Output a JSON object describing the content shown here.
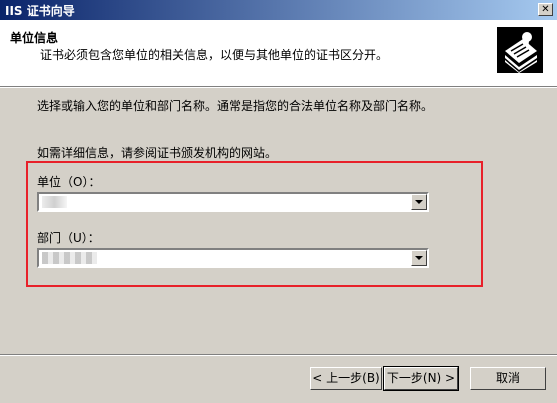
{
  "window": {
    "title": "IIS 证书向导",
    "close_symbol": "✕"
  },
  "header": {
    "title": "单位信息",
    "subtitle": "证书必须包含您单位的相关信息，以便与其他单位的证书区分开。",
    "icon": "certificate-wizard-icon"
  },
  "body": {
    "instruction": "选择或输入您的单位和部门名称。通常是指您的合法单位名称及部门名称。",
    "more_info": "如需详细信息，请参阅证书颁发机构的网站。"
  },
  "form": {
    "organization_label": "单位（O）：",
    "department_label": "部门（U）："
  },
  "buttons": {
    "back": "< 上一步(B)",
    "next": "下一步(N) >",
    "cancel": "取消"
  },
  "colors": {
    "title_bar": "#0a246a",
    "highlight_border": "#e8202a",
    "dialog_bg": "#d4d0c8"
  }
}
